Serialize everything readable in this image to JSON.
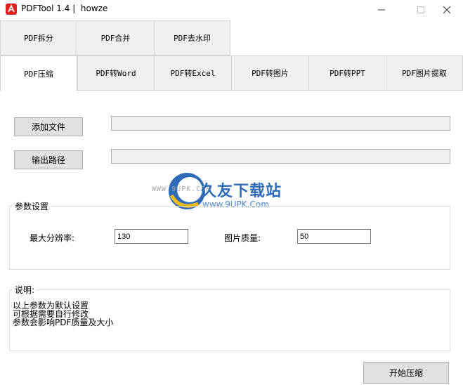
{
  "window": {
    "title": "PDFTool 1.4 |  howze",
    "minimize_icon": "minimize-icon",
    "maximize_icon": "maximize-icon",
    "close_icon": "close-icon"
  },
  "tabs_row1": [
    {
      "label": "PDF拆分"
    },
    {
      "label": "PDF合并"
    },
    {
      "label": "PDF去水印"
    }
  ],
  "tabs_row2": [
    {
      "label": "PDF压缩",
      "active": true
    },
    {
      "label": "PDF转Word"
    },
    {
      "label": "PDF转Excel"
    },
    {
      "label": "PDF转图片"
    },
    {
      "label": "PDF转PPT"
    },
    {
      "label": "PDF图片提取"
    }
  ],
  "main": {
    "add_file_button": "添加文件",
    "add_file_value": "",
    "output_path_button": "输出路径",
    "output_path_value": "",
    "params_group_label": "参数设置",
    "max_resolution_label": "最大分辨率:",
    "max_resolution_value": "130",
    "image_quality_label": "图片质量:",
    "image_quality_value": "50",
    "notes_group_label": "说明:",
    "notes": [
      "以上参数为默认设置",
      "可根据需要自行修改",
      "参数会影响PDF质量及大小"
    ],
    "start_button": "开始压缩"
  },
  "watermark": {
    "site_text": "WWW.9UPK.COM",
    "brand_text": "久友下载站",
    "url_text": "www.9UPK.Com"
  }
}
